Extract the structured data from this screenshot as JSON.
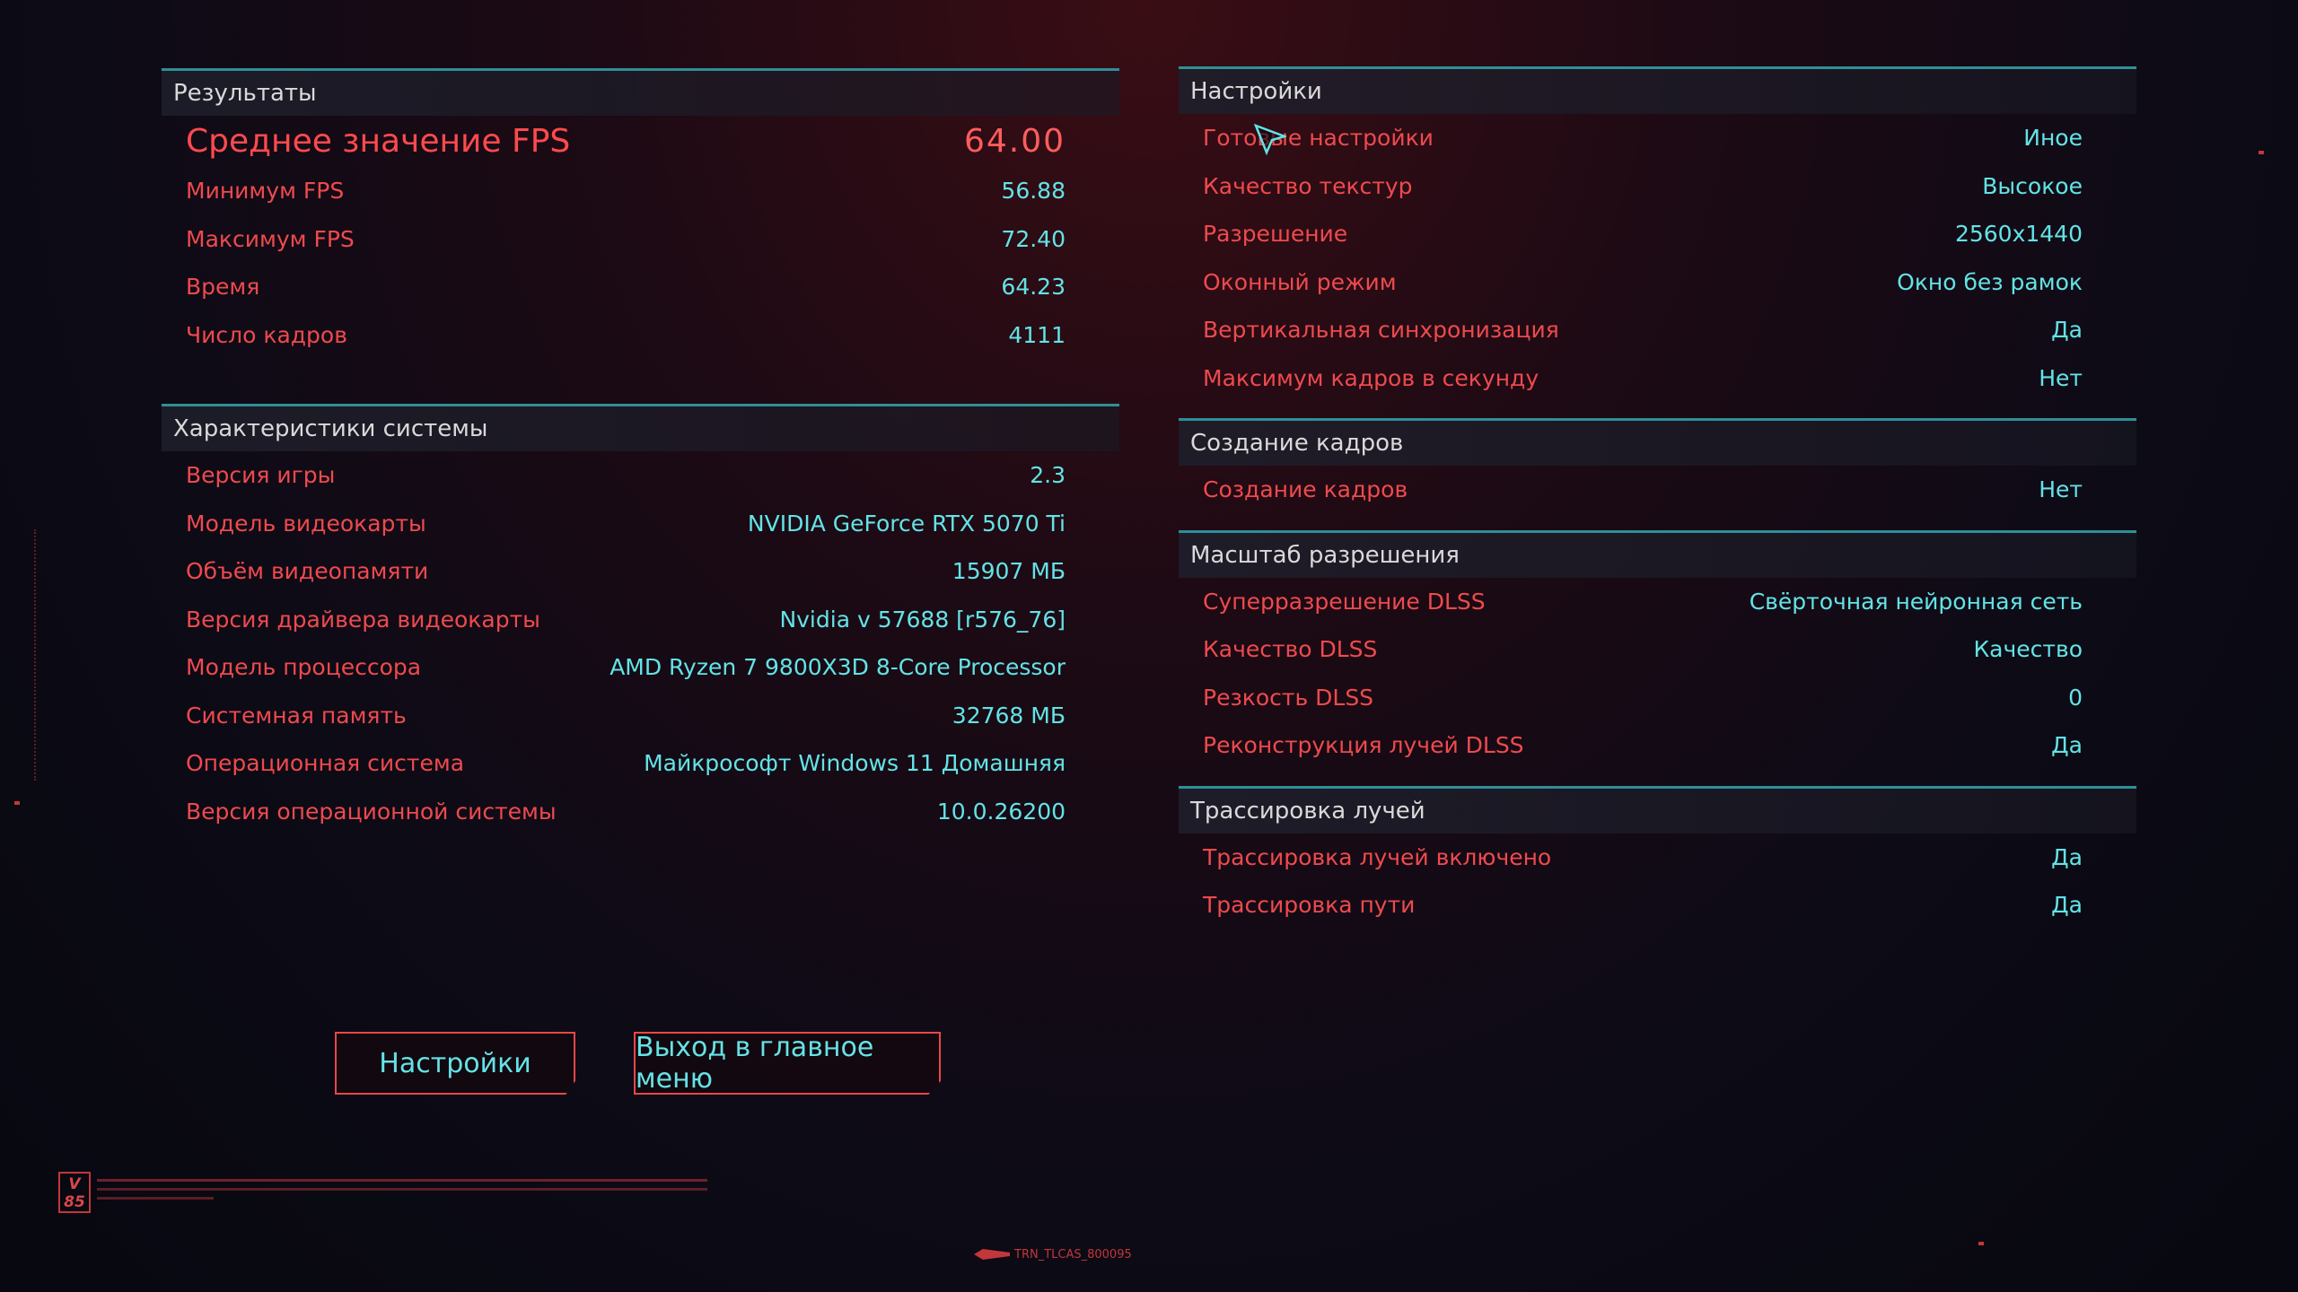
{
  "results": {
    "title": "Результаты",
    "avg_fps_label": "Среднее значение FPS",
    "avg_fps_value": "64.00",
    "rows": [
      {
        "label": "Минимум FPS",
        "value": "56.88"
      },
      {
        "label": "Максимум FPS",
        "value": "72.40"
      },
      {
        "label": "Время",
        "value": "64.23"
      },
      {
        "label": "Число кадров",
        "value": "4111"
      }
    ]
  },
  "system": {
    "title": "Характеристики системы",
    "rows": [
      {
        "label": "Версия игры",
        "value": "2.3"
      },
      {
        "label": "Модель видеокарты",
        "value": "NVIDIA GeForce RTX 5070 Ti"
      },
      {
        "label": "Объём видеопамяти",
        "value": "15907 МБ"
      },
      {
        "label": "Версия драйвера видеокарты",
        "value": "Nvidia v 57688 [r576_76]"
      },
      {
        "label": "Модель процессора",
        "value": "AMD Ryzen 7 9800X3D 8-Core Processor"
      },
      {
        "label": "Системная память",
        "value": "32768 МБ"
      },
      {
        "label": "Операционная система",
        "value": "Майкрософт Windows 11 Домашняя"
      },
      {
        "label": "Версия операционной системы",
        "value": "10.0.26200"
      }
    ]
  },
  "settings": {
    "title": "Настройки",
    "rows": [
      {
        "label": "Готовые настройки",
        "value": "Иное"
      },
      {
        "label": "Качество текстур",
        "value": "Высокое"
      },
      {
        "label": "Разрешение",
        "value": "2560x1440"
      },
      {
        "label": "Оконный режим",
        "value": "Окно без рамок"
      },
      {
        "label": "Вертикальная синхронизация",
        "value": "Да"
      },
      {
        "label": "Максимум кадров в секунду",
        "value": "Нет"
      }
    ]
  },
  "frame_gen": {
    "title": "Создание кадров",
    "rows": [
      {
        "label": "Создание кадров",
        "value": "Нет"
      }
    ]
  },
  "res_scale": {
    "title": "Масштаб разрешения",
    "rows": [
      {
        "label": "Суперразрешение DLSS",
        "value": "Свёрточная нейронная сеть"
      },
      {
        "label": "Качество DLSS",
        "value": "Качество"
      },
      {
        "label": "Резкость DLSS",
        "value": "0"
      },
      {
        "label": "Реконструкция лучей DLSS",
        "value": "Да"
      }
    ]
  },
  "ray_tracing": {
    "title": "Трассировка лучей",
    "rows": [
      {
        "label": "Трассировка лучей включено",
        "value": "Да"
      },
      {
        "label": "Трассировка пути",
        "value": "Да"
      }
    ]
  },
  "buttons": {
    "settings": "Настройки",
    "exit": "Выход в главное меню"
  },
  "footer": {
    "logo": "V 85",
    "code": "TRN_TLCAS_800095"
  },
  "colors": {
    "label": "#ee4a4e",
    "value": "#63e3e6",
    "accent_line": "#2f8f98"
  }
}
